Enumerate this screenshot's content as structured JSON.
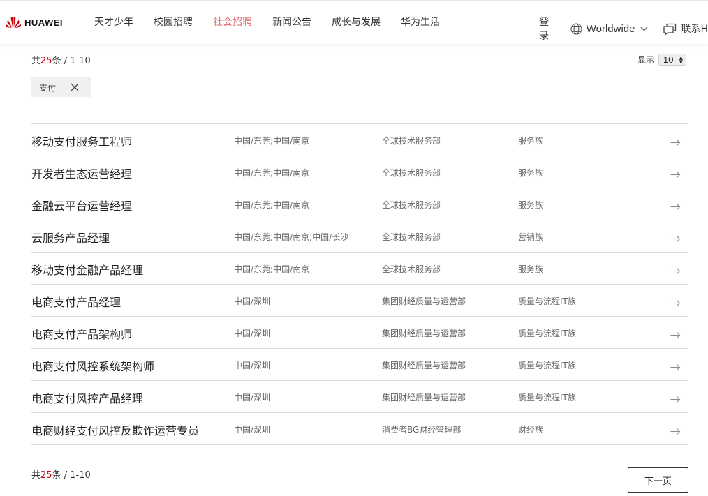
{
  "header": {
    "brand": "HUAWEI",
    "nav": [
      {
        "label": "天才少年",
        "active": false
      },
      {
        "label": "校园招聘",
        "active": false
      },
      {
        "label": "社会招聘",
        "active": true
      },
      {
        "label": "新闻公告",
        "active": false
      },
      {
        "label": "成长与发展",
        "active": false
      },
      {
        "label": "华为生活",
        "active": false
      }
    ],
    "login": "登录",
    "language": "Worldwide",
    "contact": "联系H",
    "accent_color": "#e16b6b",
    "logo_color": "#c7000b"
  },
  "results": {
    "prefix": "共",
    "total": "25",
    "suffix": "条",
    "range": "/ 1-10"
  },
  "page_size": {
    "label": "显示",
    "value": "10"
  },
  "filter_chip": {
    "label": "支付",
    "remove_icon": "close-icon"
  },
  "jobs": [
    {
      "title": "移动支付服务工程师",
      "location": "中国/东莞;中国/南京",
      "department": "全球技术服务部",
      "family": "服务族"
    },
    {
      "title": "开发者生态运营经理",
      "location": "中国/东莞;中国/南京",
      "department": "全球技术服务部",
      "family": "服务族"
    },
    {
      "title": "金融云平台运营经理",
      "location": "中国/东莞;中国/南京",
      "department": "全球技术服务部",
      "family": "服务族"
    },
    {
      "title": "云服务产品经理",
      "location": "中国/东莞;中国/南京;中国/长沙",
      "department": "全球技术服务部",
      "family": "营销族"
    },
    {
      "title": "移动支付金融产品经理",
      "location": "中国/东莞;中国/南京",
      "department": "全球技术服务部",
      "family": "服务族"
    },
    {
      "title": "电商支付产品经理",
      "location": "中国/深圳",
      "department": "集团财经质量与运营部",
      "family": "质量与流程IT族"
    },
    {
      "title": "电商支付产品架构师",
      "location": "中国/深圳",
      "department": "集团财经质量与运营部",
      "family": "质量与流程IT族"
    },
    {
      "title": "电商支付风控系统架构师",
      "location": "中国/深圳",
      "department": "集团财经质量与运营部",
      "family": "质量与流程IT族"
    },
    {
      "title": "电商支付风控产品经理",
      "location": "中国/深圳",
      "department": "集团财经质量与运营部",
      "family": "质量与流程IT族"
    },
    {
      "title": "电商财经支付风控反欺诈运营专员",
      "location": "中国/深圳",
      "department": "消费者BG财经管理部",
      "family": "财经族"
    }
  ],
  "pagination": {
    "next_label": "下一页"
  }
}
